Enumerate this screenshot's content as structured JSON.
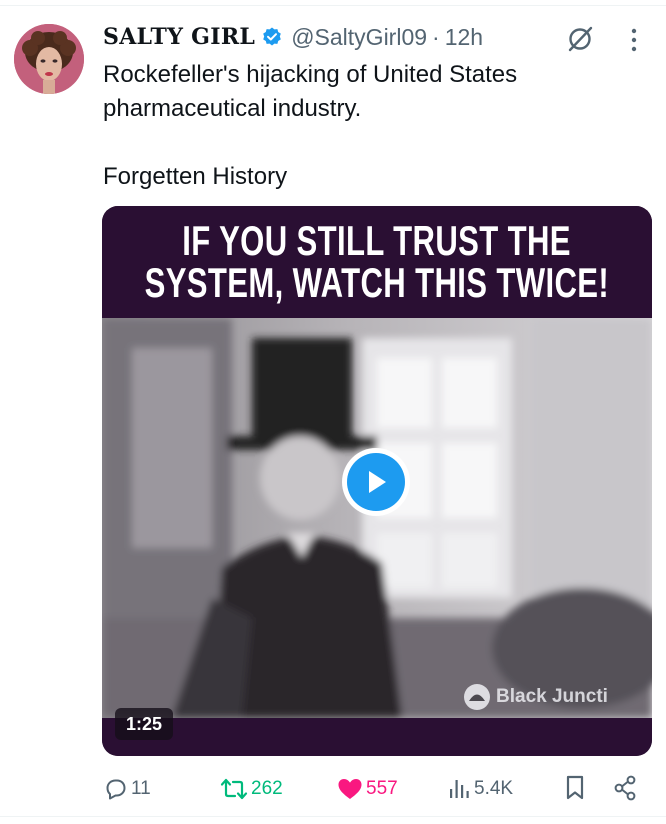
{
  "tweet": {
    "display_name": "SALTY GIRL",
    "handle": "@SaltyGirl09",
    "separator": "·",
    "time": "12h",
    "text_line1": "Rockefeller's hijacking of United States pharmaceutical industry.",
    "text_line2": "Forgetten History"
  },
  "media": {
    "banner_line1": "IF YOU STILL TRUST THE",
    "banner_line2": "SYSTEM, WATCH THIS TWICE!",
    "watermark": "Black Juncti",
    "duration": "1:25"
  },
  "actions": {
    "replies": "11",
    "reposts": "262",
    "likes": "557",
    "views": "5.4K"
  },
  "icons": {
    "verified": "verified-badge-icon",
    "grok": "grok-icon",
    "more": "more-options-icon",
    "reply": "reply-icon",
    "repost": "repost-icon",
    "like": "heart-icon",
    "views": "views-chart-icon",
    "bookmark": "bookmark-icon",
    "share": "share-icon",
    "play": "play-icon"
  },
  "colors": {
    "accent": "#1d9bf0",
    "repost": "#00ba7c",
    "like": "#f91880",
    "muted": "#536471",
    "banner": "#2a0f33"
  }
}
